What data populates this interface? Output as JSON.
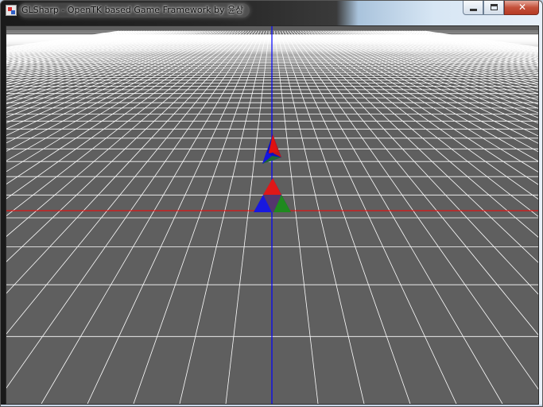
{
  "window": {
    "title": "GLSharp - OpenTK based Game Framework by 윤상",
    "icon": "app-icon",
    "buttons": {
      "minimize_icon": "minimize-icon",
      "maximize_icon": "maximize-icon",
      "close_glyph": "✕"
    }
  },
  "scene": {
    "background_color": "#5f5f5f",
    "grid_color": "#ffffff",
    "x_axis_color": "#ff0000",
    "z_axis_color": "#0000ff",
    "triangle_vertex_colors": [
      "#ff0000",
      "#00ff00",
      "#0000ff"
    ],
    "objects": [
      "triangle-near",
      "triangle-far"
    ]
  }
}
